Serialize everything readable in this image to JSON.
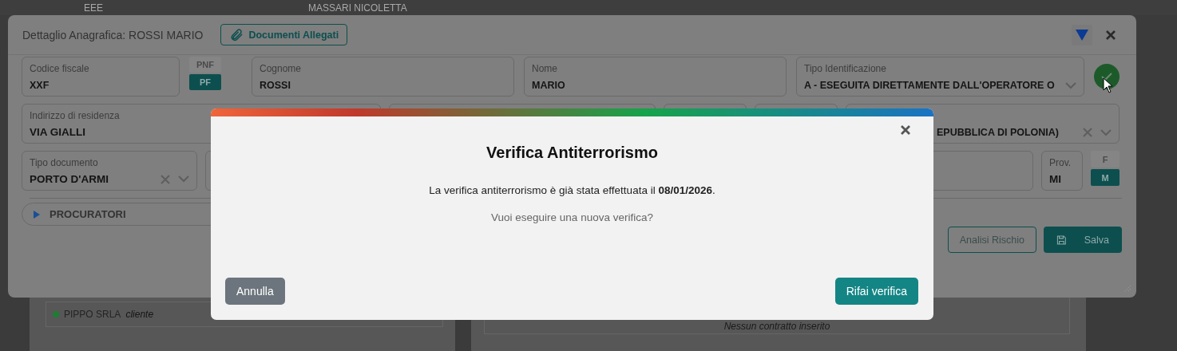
{
  "background": {
    "table_row": [
      "EEE",
      "MASSARI NICOLETTA"
    ],
    "client": {
      "name": "PIPPO SRLA",
      "role": "cliente",
      "color": "#1e7d32"
    },
    "contracts_empty": "Nessun contratto inserito"
  },
  "detail": {
    "title": "Dettaglio Anagrafica: ROSSI MARIO",
    "attachments_button": "Documenti Allegati",
    "rows": [
      [
        {
          "kind": "text",
          "label": "Codice fiscale",
          "value": "XXF"
        },
        {
          "kind": "toggle",
          "options": [
            {
              "label": "PNF",
              "selected": false
            },
            {
              "label": "PF",
              "selected": true
            }
          ]
        },
        {
          "kind": "text",
          "label": "Cognome",
          "value": "ROSSI"
        },
        {
          "kind": "text",
          "label": "Nome",
          "value": "MARIO"
        },
        {
          "kind": "select",
          "label": "Tipo Identificazione",
          "value": "A - ESEGUITA DIRETTAMENTE DALL'OPERATORE O",
          "clearable": false
        },
        {
          "kind": "confirm"
        }
      ],
      [
        {
          "kind": "text",
          "label": "Indirizzo di residenza",
          "value": "VIA GIALLI"
        },
        {
          "kind": "text"
        },
        {
          "kind": "text"
        },
        {
          "kind": "text"
        },
        {
          "kind": "select",
          "value": "EPUBBLICA DI POLONIA)",
          "clearable": true
        }
      ],
      [
        {
          "kind": "select",
          "label": "Tipo documento",
          "value": "PORTO D'ARMI",
          "clearable": true
        },
        {
          "kind": "text"
        },
        {
          "kind": "text"
        },
        {
          "kind": "text",
          "label": "Prov.",
          "value": "MI"
        },
        {
          "kind": "toggle",
          "options": [
            {
              "label": "F",
              "selected": false
            },
            {
              "label": "M",
              "selected": true
            }
          ]
        }
      ]
    ],
    "section": {
      "label": "PROCURATORI",
      "expanded": false
    },
    "actions": [
      {
        "label": "Analisi Rischio",
        "kind": "outline"
      },
      {
        "label": "Salva",
        "kind": "save"
      }
    ]
  },
  "dialog": {
    "title": "Verifica Antiterrorismo",
    "message": "La verifica antiterrorismo è già stata effettuata il **08/01/2026**.",
    "question": "Vuoi eseguire una nuova verifica?",
    "buttons": [
      {
        "label": "Annulla",
        "kind": "cancel"
      },
      {
        "label": "Rifai verifica",
        "kind": "confirm"
      }
    ]
  }
}
